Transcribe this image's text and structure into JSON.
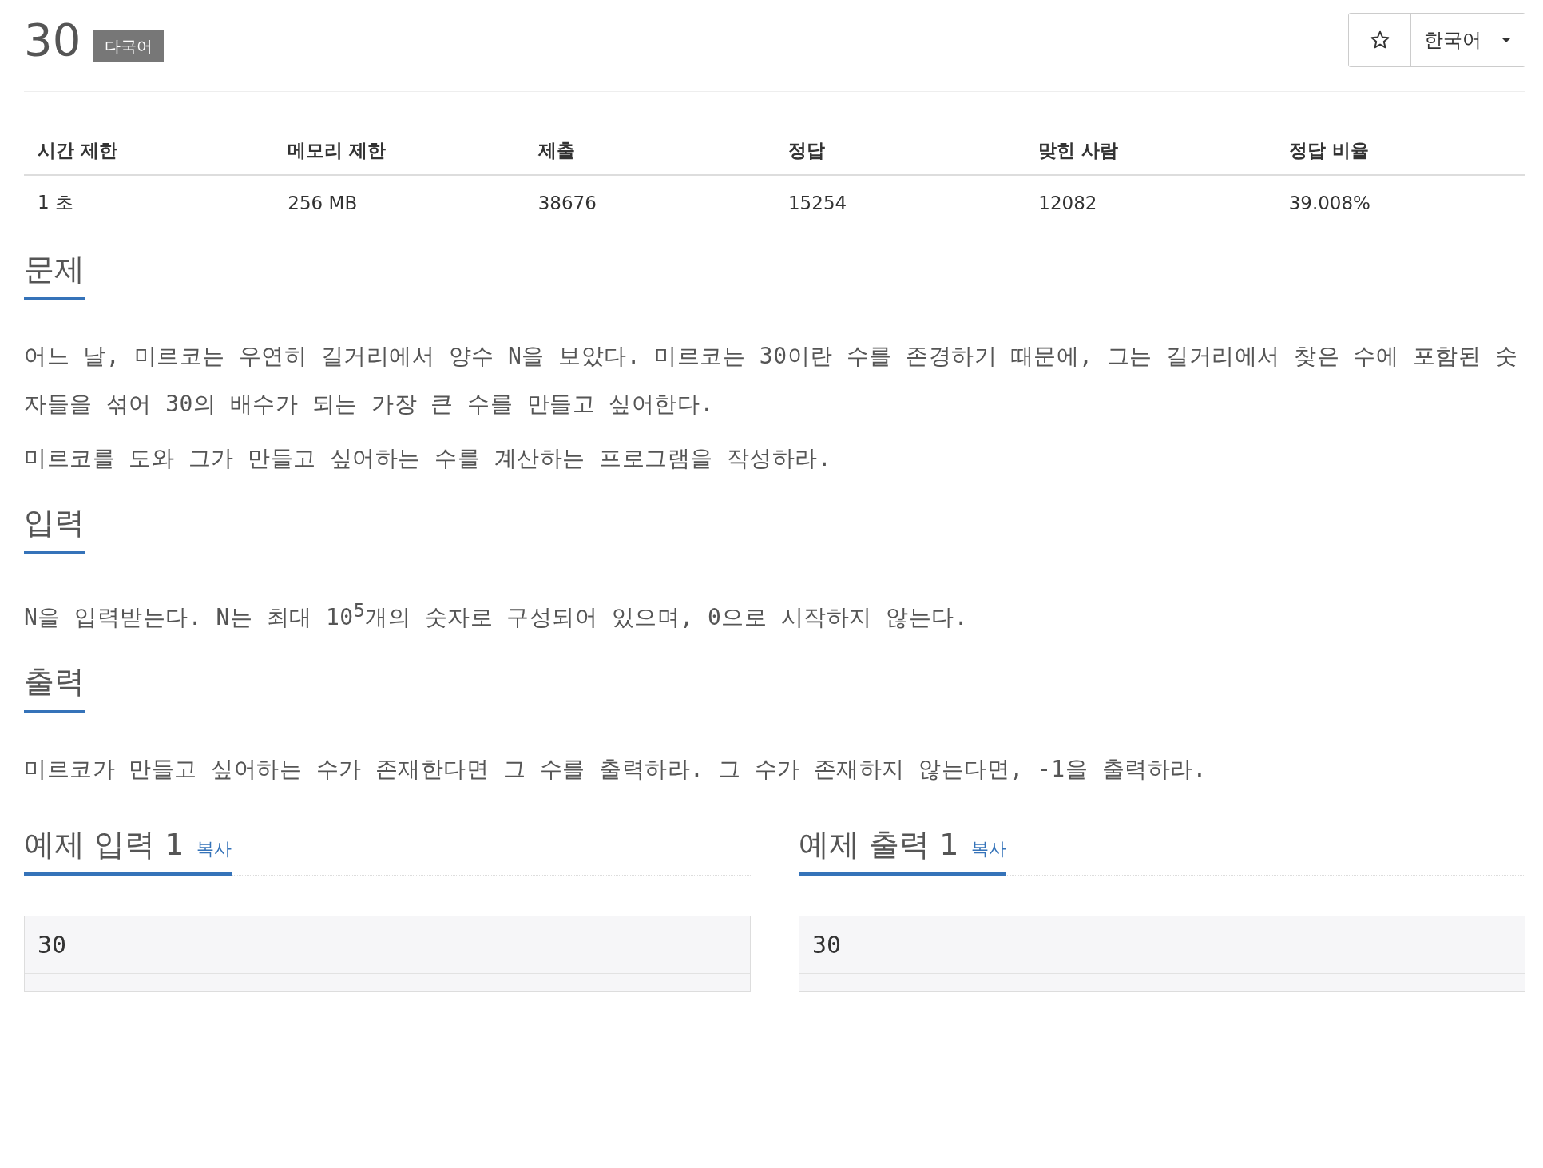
{
  "header": {
    "title": "30",
    "badge": "다국어",
    "language": "한국어"
  },
  "stats": {
    "columns": [
      "시간 제한",
      "메모리 제한",
      "제출",
      "정답",
      "맞힌 사람",
      "정답 비율"
    ],
    "rows": [
      [
        "1 초",
        "256 MB",
        "38676",
        "15254",
        "12082",
        "39.008%"
      ]
    ]
  },
  "sections": [
    {
      "title": "문제",
      "paragraphs": [
        "어느 날, 미르코는 우연히 길거리에서 양수 N을 보았다. 미르코는 30이란 수를 존경하기 때문에, 그는 길거리에서 찾은 수에 포함된 숫자들을 섞어 30의 배수가 되는 가장 큰 수를 만들고 싶어한다.",
        "미르코를 도와 그가 만들고 싶어하는 수를 계산하는 프로그램을 작성하라."
      ]
    },
    {
      "title": "입력",
      "paragraphs": [
        "N을 입력받는다. N는 최대 10$^{5}$개의 숫자로 구성되어 있으며, 0으로 시작하지 않는다."
      ]
    },
    {
      "title": "출력",
      "paragraphs": [
        "미르코가 만들고 싶어하는 수가 존재한다면 그 수를 출력하라. 그 수가 존재하지 않는다면, -1을 출력하라."
      ]
    }
  ],
  "samples": [
    {
      "title": "예제 입력 1",
      "copy": "복사",
      "content": "30"
    },
    {
      "title": "예제 출력 1",
      "copy": "복사",
      "content": "30"
    }
  ]
}
